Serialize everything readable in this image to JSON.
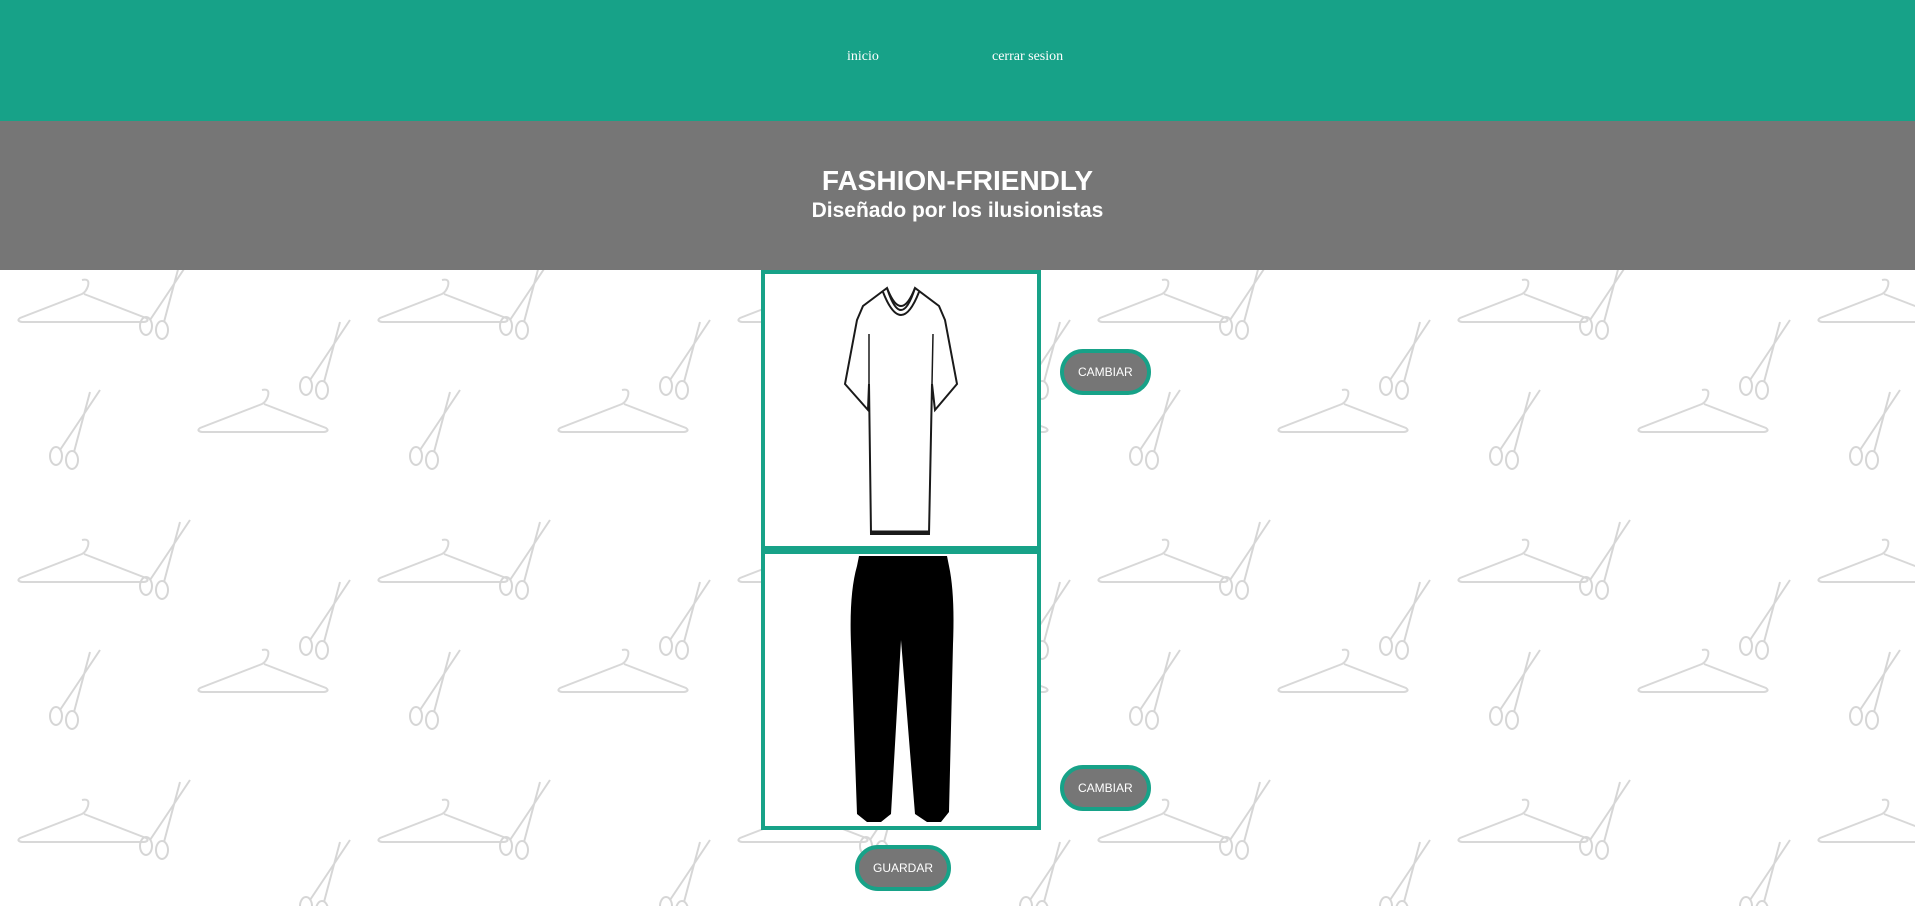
{
  "nav": {
    "home_label": "inicio",
    "logout_label": "cerrar sesion"
  },
  "header": {
    "title": "FASHION-FRIENDLY",
    "subtitle": "Diseñado por los ilusionistas"
  },
  "outfit": {
    "top_image_icon": "tshirt-outline",
    "bottom_image_icon": "pants-black",
    "change_top_label": "CAMBIAR",
    "change_bottom_label": "CAMBIAR",
    "save_label": "GUARDAR"
  },
  "colors": {
    "accent": "#17a288",
    "banner": "#767676",
    "button": "#767676"
  }
}
